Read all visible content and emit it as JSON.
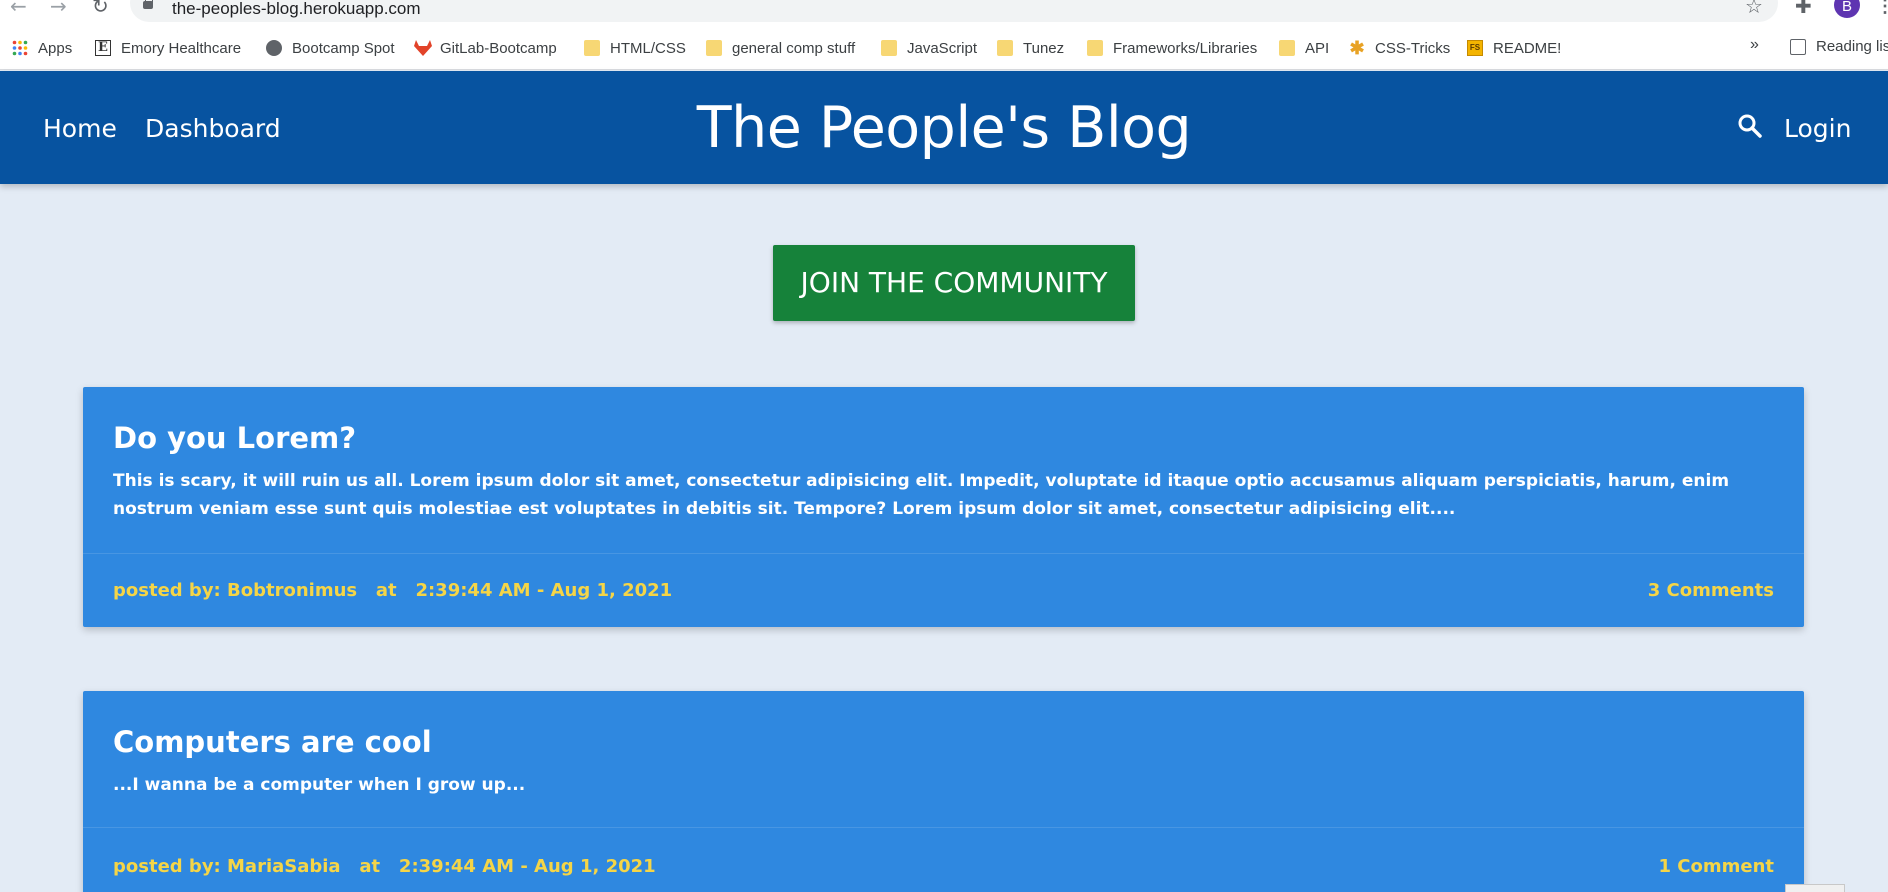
{
  "browser": {
    "url": "the-peoples-blog.herokuapp.com",
    "profile_initial": "B",
    "bookmarks": [
      {
        "label": "Apps",
        "icon": "apps-grid-icon"
      },
      {
        "label": "Emory Healthcare",
        "icon": "emory-icon"
      },
      {
        "label": "Bootcamp Spot",
        "icon": "globe-icon"
      },
      {
        "label": "GitLab-Bootcamp",
        "icon": "gitlab-icon"
      },
      {
        "label": "HTML/CSS",
        "icon": "folder-icon"
      },
      {
        "label": "general comp stuff",
        "icon": "folder-icon"
      },
      {
        "label": "JavaScript",
        "icon": "folder-icon"
      },
      {
        "label": "Tunez",
        "icon": "folder-icon"
      },
      {
        "label": "Frameworks/Libraries",
        "icon": "folder-icon"
      },
      {
        "label": "API",
        "icon": "folder-icon"
      },
      {
        "label": "CSS-Tricks",
        "icon": "css-tricks-icon"
      },
      {
        "label": "README!",
        "icon": "fs-icon"
      }
    ],
    "more": "»",
    "reading_list": "Reading list"
  },
  "header": {
    "home": "Home",
    "dashboard": "Dashboard",
    "title": "The People's Blog",
    "login": "Login",
    "bg_color": "#0753a0"
  },
  "cta": {
    "label": "JOIN THE COMMUNITY",
    "color": "#16823a"
  },
  "posts": [
    {
      "title": "Do you Lorem?",
      "body": "This is scary, it will ruin us all. Lorem ipsum dolor sit amet, consectetur adipisicing elit. Impedit, voluptate id itaque optio accusamus aliquam perspiciatis, harum, enim nostrum veniam esse sunt quis molestiae est voluptates in debitis sit. Tempore? Lorem ipsum dolor sit amet, consectetur adipisicing elit....",
      "meta": "posted by: Bobtronimus   at   2:39:44 AM - Aug 1, 2021",
      "comments": "3 Comments"
    },
    {
      "title": "Computers are cool",
      "body": "...I wanna be a computer when I grow up...",
      "meta": "posted by: MariaSabia   at   2:39:44 AM - Aug 1, 2021",
      "comments": "1 Comment"
    }
  ],
  "colors": {
    "page_bg": "#e3ebf5",
    "card_bg": "#2f88e0",
    "meta_text": "#f5d547"
  }
}
